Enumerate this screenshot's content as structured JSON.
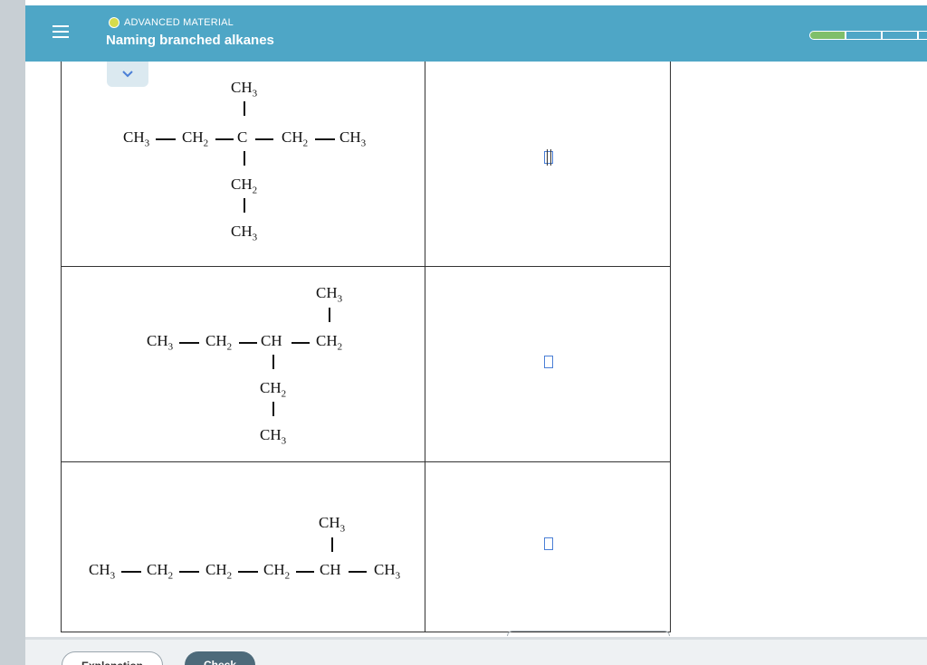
{
  "header": {
    "topic_label": "ADVANCED MATERIAL",
    "title": "Naming branched alkanes",
    "progress_segments": 4,
    "progress_done": 1
  },
  "colors": {
    "header_bg": "#4ea6c6",
    "topic_dot": "#d6dc4b",
    "progress_done": "#7fbf6a",
    "answer_box_border": "#4b7fd6",
    "check_button": "#4d6a7a"
  },
  "icons": {
    "menu": "hamburger-menu-icon",
    "collapse": "chevron-down-icon"
  },
  "molecules": [
    {
      "top": "CH",
      "top_sub": "3",
      "chain": [
        "CH",
        "CH",
        "C",
        "CH",
        "CH"
      ],
      "chain_subs": [
        "3",
        "2",
        "",
        "2",
        "3"
      ],
      "below1": "CH",
      "below1_sub": "2",
      "below2": "CH",
      "below2_sub": "3",
      "answer": ""
    },
    {
      "top": "CH",
      "top_sub": "3",
      "chain": [
        "CH",
        "CH",
        "CH",
        "CH"
      ],
      "chain_subs": [
        "3",
        "2",
        "",
        "2"
      ],
      "below1": "CH",
      "below1_sub": "2",
      "below2": "CH",
      "below2_sub": "3",
      "answer": ""
    },
    {
      "top": "CH",
      "top_sub": "3",
      "chain": [
        "CH",
        "CH",
        "CH",
        "CH",
        "CH",
        "CH"
      ],
      "chain_subs": [
        "3",
        "2",
        "2",
        "2",
        "",
        "3"
      ],
      "answer": ""
    }
  ],
  "footer": {
    "explanation_label": "Explanation",
    "check_label": "Check"
  }
}
